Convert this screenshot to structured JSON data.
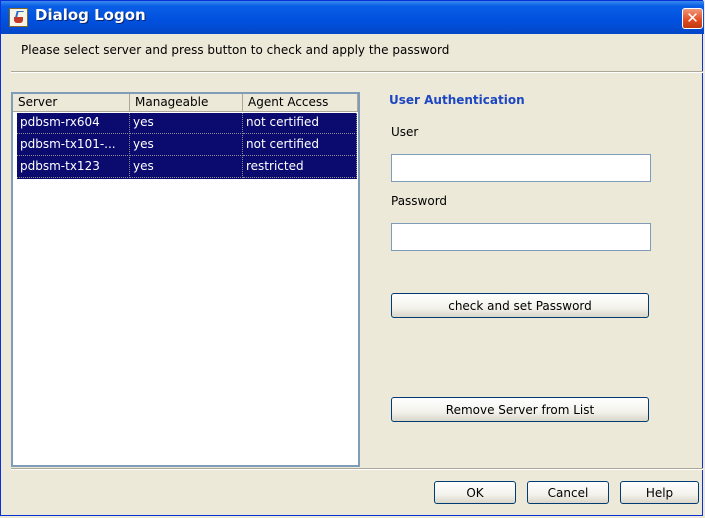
{
  "window": {
    "title": "Dialog Logon",
    "close_symbol": "✕"
  },
  "instruction": "Please select server and press button to check and apply the password",
  "server_table": {
    "columns": [
      "Server",
      "Manageable",
      "Agent Access"
    ],
    "rows": [
      [
        "pdbsm-rx604",
        "yes",
        "not certified"
      ],
      [
        "pdbsm-tx101-...",
        "yes",
        "not certified"
      ],
      [
        "pdbsm-tx123",
        "yes",
        "restricted"
      ]
    ]
  },
  "auth": {
    "title": "User Authentication",
    "user_label": "User",
    "user_value": "",
    "password_label": "Password",
    "password_value": "",
    "check_button": "check and set Password",
    "remove_button": "Remove Server from List"
  },
  "footer": {
    "ok": "OK",
    "cancel": "Cancel",
    "help": "Help"
  },
  "colors": {
    "title_bar": "#0050de",
    "selection": "#0a0a6f",
    "section_title": "#1d47c2",
    "close_button": "#e14a20"
  }
}
